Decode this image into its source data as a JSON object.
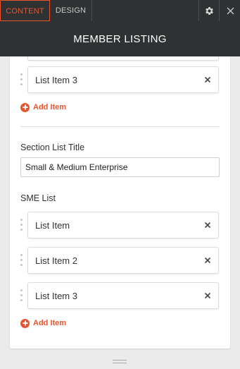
{
  "tabs": {
    "content": "CONTENT",
    "design": "DESIGN"
  },
  "header": {
    "title": "MEMBER LISTING"
  },
  "list1": {
    "items": [
      "List Item 3"
    ],
    "add_label": "Add Item"
  },
  "section_title": {
    "label": "Section List Title",
    "value": "Small & Medium Enterprise"
  },
  "sme_list": {
    "label": "SME List",
    "items": [
      "List Item",
      "List Item 2",
      "List Item 3"
    ],
    "add_label": "Add Item"
  },
  "colors": {
    "accent": "#e8542e",
    "topbar": "#2f3233",
    "background": "#ebebeb"
  }
}
